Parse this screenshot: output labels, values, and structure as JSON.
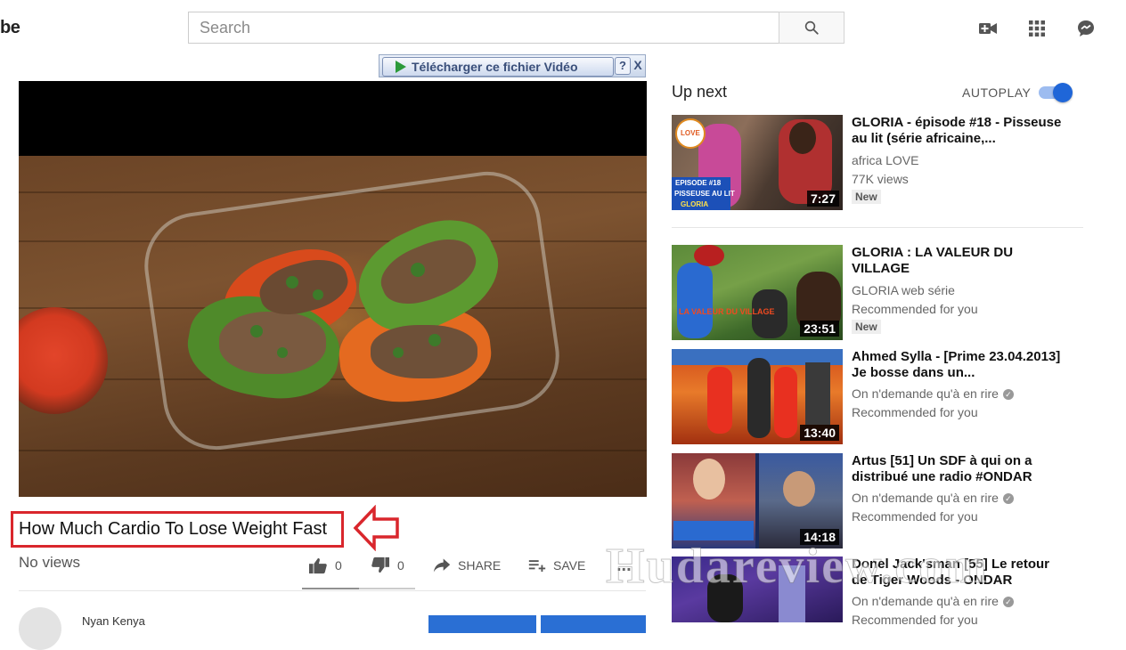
{
  "header": {
    "logo_text": "be",
    "search": {
      "placeholder": "Search",
      "value": ""
    },
    "icons": [
      "search-icon",
      "video-camera-icon",
      "apps-grid-icon",
      "messages-icon"
    ]
  },
  "download_bar": {
    "button_label": "Télécharger ce fichier Vidéo",
    "help_label": "?",
    "close_label": "X"
  },
  "video": {
    "title": "How Much Cardio To Lose Weight Fast",
    "views": "No views",
    "actions": {
      "likes": "0",
      "dislikes": "0",
      "share_label": "SHARE",
      "save_label": "SAVE",
      "more_label": "..."
    },
    "like_ratio": 0.5,
    "channel_name": "Nyan Kenya"
  },
  "sidebar": {
    "up_next_label": "Up next",
    "autoplay_label": "AUTOPLAY",
    "autoplay_on": true,
    "items": [
      {
        "title": "GLORIA - épisode #18 - Pisseuse au lit (série africaine,...",
        "channel": "africa LOVE",
        "meta": "77K views",
        "badge": "New",
        "duration": "7:27",
        "thumb_label_1": "EPISODE #18",
        "thumb_label_2": "PISSEUSE AU LIT",
        "thumb_label_3": "GLORIA",
        "thumb_logo": "LOVE"
      },
      {
        "title": "GLORIA : LA VALEUR DU VILLAGE",
        "channel": "GLORIA web série",
        "meta": "Recommended for you",
        "badge": "New",
        "duration": "23:51",
        "thumb_label_1": "LA VALEUR DU VILLAGE"
      },
      {
        "title": "Ahmed Sylla - [Prime 23.04.2013] Je bosse dans un...",
        "channel": "On n'demande qu'à en rire",
        "meta": "Recommended for you",
        "duration": "13:40"
      },
      {
        "title": "Artus [51] Un SDF à qui on a distribué une radio #ONDAR",
        "channel": "On n'demande qu'à en rire",
        "meta": "Recommended for you",
        "duration": "14:18"
      },
      {
        "title": "Donel Jack'sman [55] Le retour de Tiger Woods - ONDAR",
        "channel": "On n'demande qu'à en rire",
        "meta": "Recommended for you"
      }
    ]
  },
  "watermark": "Hudareview.com",
  "colors": {
    "accent_blue": "#1f66d8",
    "annotation_red": "#d9262c",
    "duration_bg": "#000000"
  }
}
